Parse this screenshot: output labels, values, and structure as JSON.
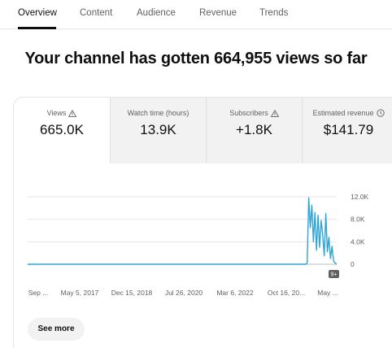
{
  "tabs": [
    {
      "label": "Overview",
      "active": true
    },
    {
      "label": "Content",
      "active": false
    },
    {
      "label": "Audience",
      "active": false
    },
    {
      "label": "Revenue",
      "active": false
    },
    {
      "label": "Trends",
      "active": false
    }
  ],
  "headline": "Your channel has gotten 664,955 views so far",
  "metrics": [
    {
      "label": "Views",
      "value": "665.0K",
      "icon": "warning-icon",
      "selected": true
    },
    {
      "label": "Watch time (hours)",
      "value": "13.9K",
      "icon": "",
      "selected": false
    },
    {
      "label": "Subscribers",
      "value": "+1.8K",
      "icon": "warning-icon",
      "selected": false
    },
    {
      "label": "Estimated revenue",
      "value": "$141.79",
      "icon": "clock-icon",
      "selected": false
    }
  ],
  "chart_data": {
    "type": "line",
    "series_color": "#2ea3d5",
    "y_ticks": [
      "12.0K",
      "8.0K",
      "4.0K",
      "0"
    ],
    "ylim": [
      0,
      12000
    ],
    "x_ticks": [
      "Sep ...",
      "May 5, 2017",
      "Dec 15, 2018",
      "Jul 26, 2020",
      "Mar 6, 2022",
      "Oct 16, 20...",
      "May ..."
    ],
    "marker_badge": "9+",
    "grid": true,
    "series": [
      {
        "values": [
          0,
          0,
          0,
          0,
          0,
          0,
          0,
          0,
          0,
          0,
          0,
          0,
          0,
          0,
          0,
          0,
          0,
          0,
          0,
          0,
          0,
          0,
          0,
          0,
          0,
          0,
          0,
          0,
          0,
          0,
          0,
          0,
          0,
          0,
          0,
          0,
          0,
          0,
          0,
          0,
          0,
          0,
          0,
          0,
          0,
          0,
          0,
          0,
          0,
          0,
          0,
          0,
          0,
          0,
          0,
          0,
          0,
          0,
          0,
          0,
          0,
          0,
          0,
          0,
          0,
          0,
          0,
          0,
          0,
          0,
          0,
          0,
          0,
          0,
          0,
          0,
          0,
          0,
          0,
          0,
          0,
          0,
          0,
          0,
          0,
          0,
          0,
          0,
          0,
          0,
          0,
          0,
          0,
          0,
          0,
          0,
          0,
          0,
          0,
          0,
          0,
          0,
          0,
          0,
          0,
          0,
          0,
          0,
          0,
          0,
          0,
          0,
          0,
          0,
          0,
          0,
          0,
          0,
          0,
          0,
          0,
          0,
          0,
          0,
          0,
          0,
          0,
          0,
          0,
          0,
          0,
          0,
          0,
          0,
          0,
          0,
          0,
          0,
          0,
          0,
          0,
          0,
          0,
          0,
          0,
          0,
          0,
          0,
          0,
          0,
          0,
          0,
          0,
          0,
          0,
          0,
          0,
          0,
          0,
          0,
          0,
          0,
          0,
          0,
          0,
          0,
          0,
          0,
          0,
          0,
          0,
          0,
          0,
          0,
          0,
          0,
          0,
          0,
          0,
          0,
          200,
          11800,
          6500,
          10500,
          4000,
          9200,
          2500,
          8700,
          3000,
          7800,
          5200,
          1500,
          9000,
          2200,
          4800,
          1000,
          3200,
          600,
          200,
          0
        ]
      }
    ]
  },
  "see_more_label": "See more"
}
